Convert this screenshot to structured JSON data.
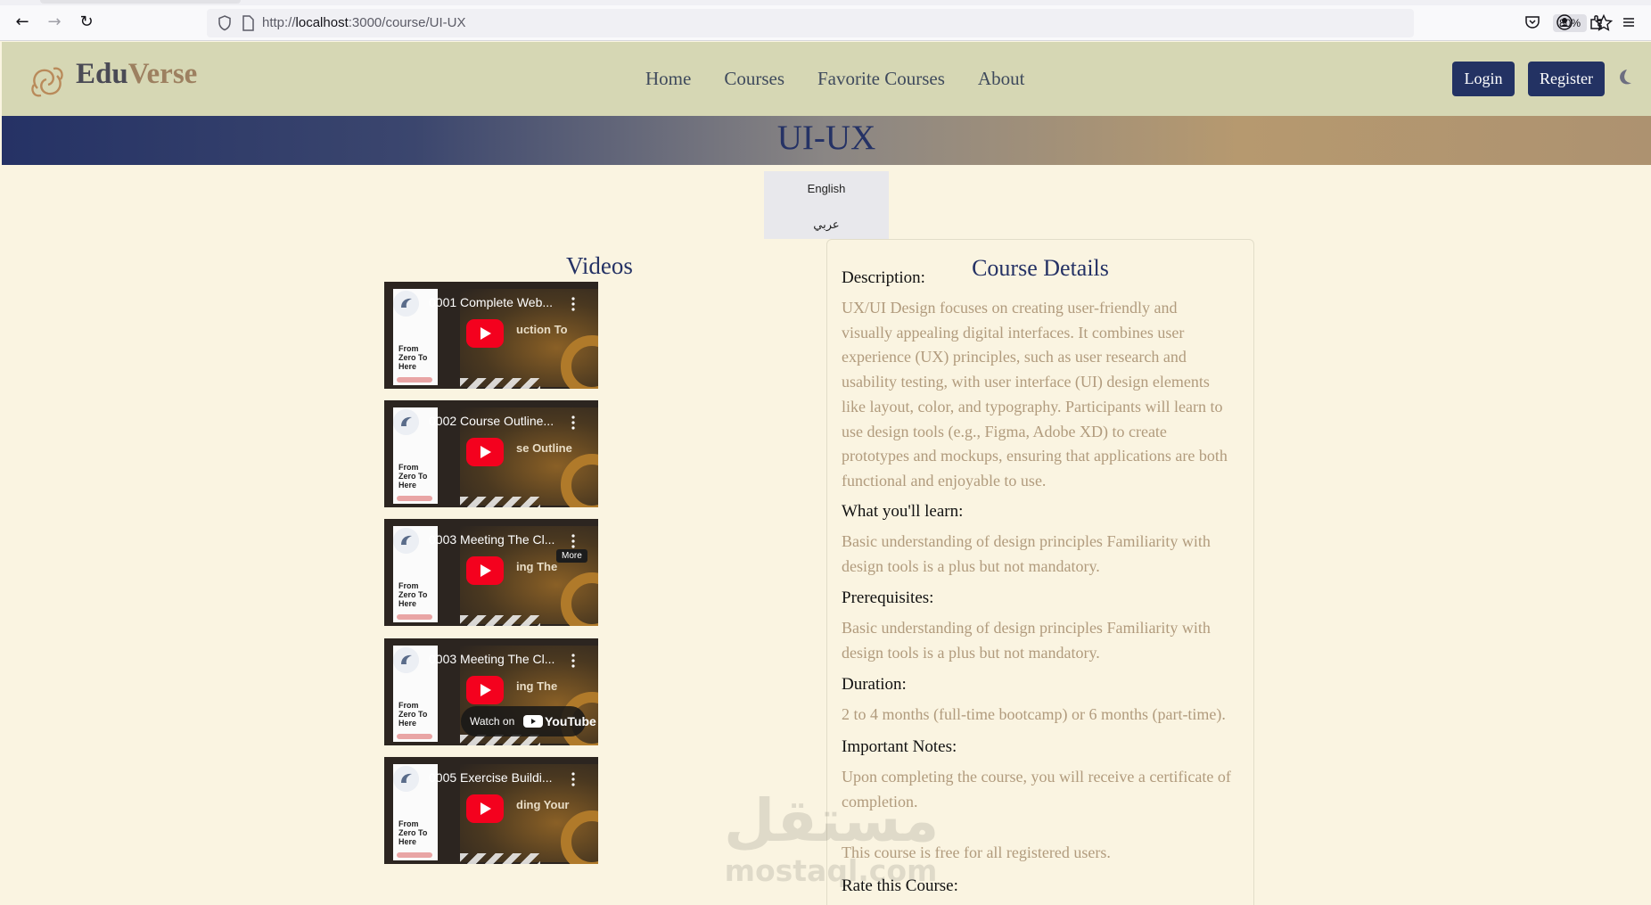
{
  "browser": {
    "url_prefix": "http://",
    "url_host": "localhost",
    "url_path": ":3000/course/UI-UX",
    "zoom": "80%"
  },
  "navbar": {
    "logo_part1": "Edu",
    "logo_part2": "Verse",
    "menu": [
      "Home",
      "Courses",
      "Favorite Courses",
      "About"
    ],
    "login_label": "Login",
    "register_label": "Register"
  },
  "banner": {
    "title": "UI-UX"
  },
  "language": {
    "english": "English",
    "arabic": "عربي"
  },
  "videos": {
    "title": "Videos",
    "items": [
      {
        "title": "0001 Complete Web...",
        "big_text": "uction To",
        "overlay": "none"
      },
      {
        "title": "0002 Course Outline...",
        "big_text": "se Outline",
        "overlay": "none"
      },
      {
        "title": "0003 Meeting The Cl...",
        "big_text": "ing The",
        "overlay": "more"
      },
      {
        "title": "0003 Meeting The Cl...",
        "big_text": "ing The",
        "overlay": "watch"
      },
      {
        "title": "0005 Exercise Buildi...",
        "big_text": "ding Your",
        "overlay": "none"
      }
    ],
    "more_label": "More",
    "watch_on_label": "Watch on",
    "youtube_label": "YouTube",
    "card_text": "From\nZero To\nHere"
  },
  "details": {
    "title": "Course Details",
    "description_label": "Description:",
    "description_lines": [
      "UX/UI Design focuses on creating user-friendly and",
      "visually appealing digital interfaces. It combines user",
      "experience (UX) principles, such as user research and",
      "usability testing, with user interface (UI) design elements",
      "like layout, color, and typography. Participants will learn to",
      "use design tools (e.g., Figma, Adobe XD) to create",
      "prototypes and mockups, ensuring that applications are both",
      "functional and enjoyable to use."
    ],
    "learn_label": "What you'll learn:",
    "learn_lines": [
      "Basic understanding of design principles Familiarity with",
      "design tools is a plus but not mandatory."
    ],
    "prereq_label": "Prerequisites:",
    "prereq_lines": [
      "Basic understanding of design principles Familiarity with",
      "design tools is a plus but not mandatory."
    ],
    "duration_label": "Duration:",
    "duration_text": "2 to 4 months (full-time bootcamp) or 6 months (part-time).",
    "notes_label": "Important Notes:",
    "notes_lines": [
      "Upon completing the course, you will receive a certificate of",
      "completion."
    ],
    "notes_extra": "This course is free for all registered users.",
    "rate_label": "Rate this Course:"
  },
  "watermark": {
    "arabic": "مستقل",
    "latin": "mostaql.com"
  },
  "colors": {
    "navbar_bg": "#d6d7b4",
    "page_bg": "#faf4e1",
    "primary_navy": "#233263",
    "accent_tan": "#b19b7d"
  }
}
